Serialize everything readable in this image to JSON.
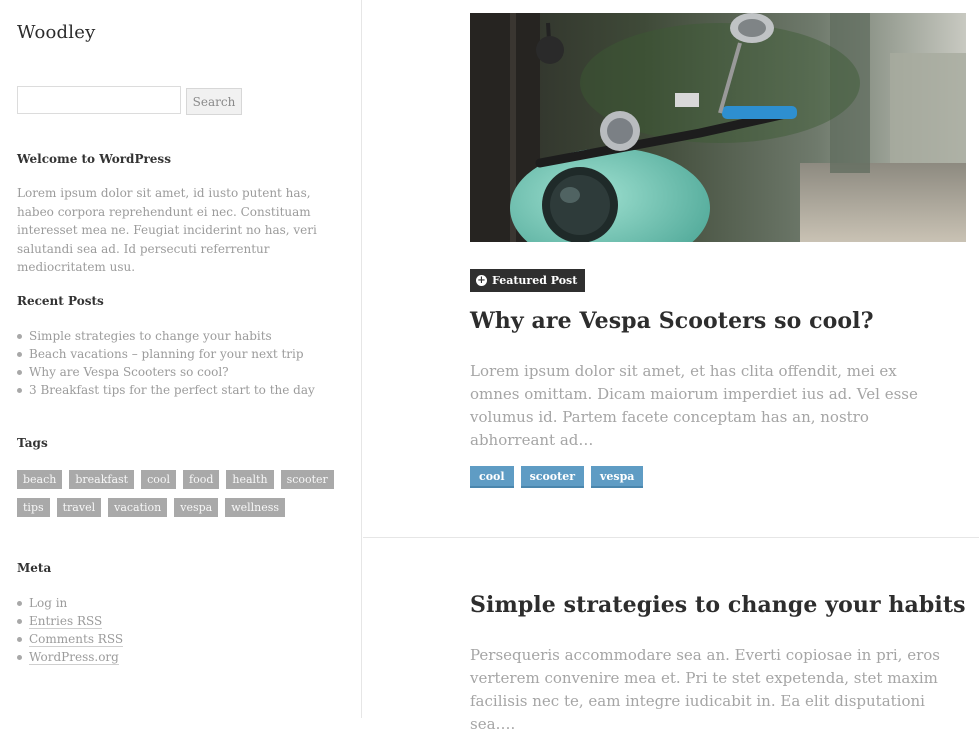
{
  "site": {
    "title": "Woodley"
  },
  "search": {
    "placeholder": "",
    "button_label": "Search"
  },
  "welcome": {
    "title": "Welcome to WordPress",
    "text": "Lorem ipsum dolor sit amet, id iusto putent has, habeo corpora reprehendunt ei nec. Constituam interesset mea ne. Feugiat inciderint no has, veri salutandi sea ad. Id persecuti referrentur mediocritatem usu."
  },
  "recent_posts": {
    "title": "Recent Posts",
    "items": [
      "Simple strategies to change your habits",
      "Beach vacations – planning for your next trip",
      "Why are Vespa Scooters so cool?",
      "3 Breakfast tips for the perfect start to the day"
    ]
  },
  "tags_widget": {
    "title": "Tags",
    "row1": [
      "beach",
      "breakfast",
      "cool",
      "food",
      "health",
      "scooter"
    ],
    "row2": [
      "tips",
      "travel",
      "vacation",
      "vespa",
      "wellness"
    ]
  },
  "meta": {
    "title": "Meta",
    "items": [
      "Log in",
      "Entries RSS",
      "Comments RSS",
      "WordPress.org"
    ]
  },
  "posts": [
    {
      "badge": "Featured Post",
      "title": "Why are Vespa Scooters so cool?",
      "excerpt": "Lorem ipsum dolor sit amet, et has clita offendit, mei ex omnes omittam. Dicam maiorum imperdiet ius ad. Vel esse volumus id. Partem facete conceptam has an, nostro abhorreant ad…",
      "tags": [
        "cool",
        "scooter",
        "vespa"
      ]
    },
    {
      "title": "Simple strategies to change your habits",
      "excerpt": "Persequeris accommodare sea an. Everti copiosae in pri, eros verterem convenire mea et. Pri te stet expetenda, stet maxim facilisis nec te, eam integre iudicabit in. Ea elit disputationi sea…."
    }
  ],
  "colors": {
    "tag_bg": "#a9a9a9",
    "post_tag_bg": "#5f9cc4",
    "badge_bg": "#2f2f2f"
  }
}
